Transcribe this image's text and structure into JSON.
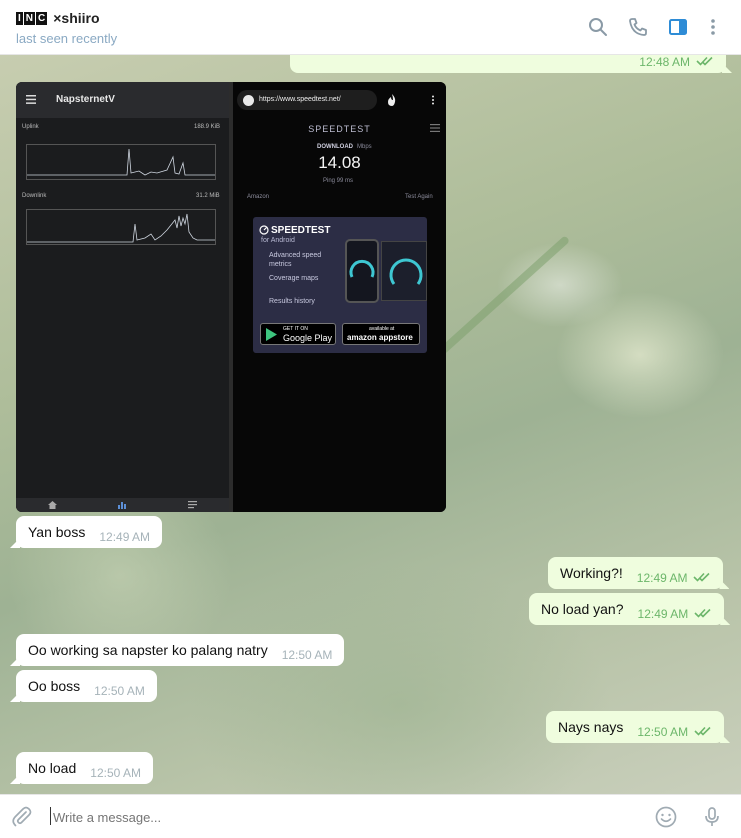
{
  "header": {
    "tag_letters": [
      "I",
      "N",
      "C"
    ],
    "name": "×shiiro",
    "status": "last seen recently",
    "icons": [
      "search-icon",
      "phone-icon",
      "sidebar-toggle-icon",
      "more-vertical-icon"
    ]
  },
  "messages": [
    {
      "dir": "out",
      "text": "",
      "time": "12:48 AM",
      "read": true
    },
    {
      "dir": "in",
      "text": "Yan boss",
      "time": "12:49 AM"
    },
    {
      "dir": "out",
      "text": "Working?!",
      "time": "12:49 AM",
      "read": true
    },
    {
      "dir": "out",
      "text": "No load yan?",
      "time": "12:49 AM",
      "read": true
    },
    {
      "dir": "in",
      "text": "Oo working sa napster ko palang natry",
      "time": "12:50 AM"
    },
    {
      "dir": "in",
      "text": "Oo boss",
      "time": "12:50 AM"
    },
    {
      "dir": "out",
      "text": "Nays nays",
      "time": "12:50 AM",
      "read": true
    },
    {
      "dir": "in",
      "text": "No load",
      "time": "12:50 AM"
    }
  ],
  "media": {
    "napster": {
      "title": "NapsternetV",
      "uplink_label": "Uplink",
      "uplink_value": "188.9 KiB",
      "downlink_label": "Downlink",
      "downlink_value": "31.2 MiB"
    },
    "speedtest": {
      "url": "https://www.speedtest.net/",
      "logo": "SPEEDTEST",
      "download_label": "DOWNLOAD",
      "download_unit": "Mbps",
      "download_value": "14.08",
      "ping": "Ping 99 ms",
      "left_meta": "Amazon",
      "right_meta": "Test Again",
      "promo_title": "SPEEDTEST",
      "promo_sub": "for Android",
      "features": [
        "Advanced speed metrics",
        "Coverage maps",
        "Results history"
      ],
      "google_top": "GET IT ON",
      "google_btn": "Google Play",
      "amazon_top": "available at",
      "amazon_btn": "amazon appstore"
    }
  },
  "composer": {
    "placeholder": "Write a message...",
    "icons": [
      "attach-icon",
      "emoji-icon",
      "microphone-icon"
    ]
  },
  "colors": {
    "outgoing_bubble": "#effdde",
    "incoming_bubble": "#ffffff",
    "read_check": "#6cb66a",
    "header_icon": "#8a9aa6",
    "accent": "#2e8cd6"
  }
}
